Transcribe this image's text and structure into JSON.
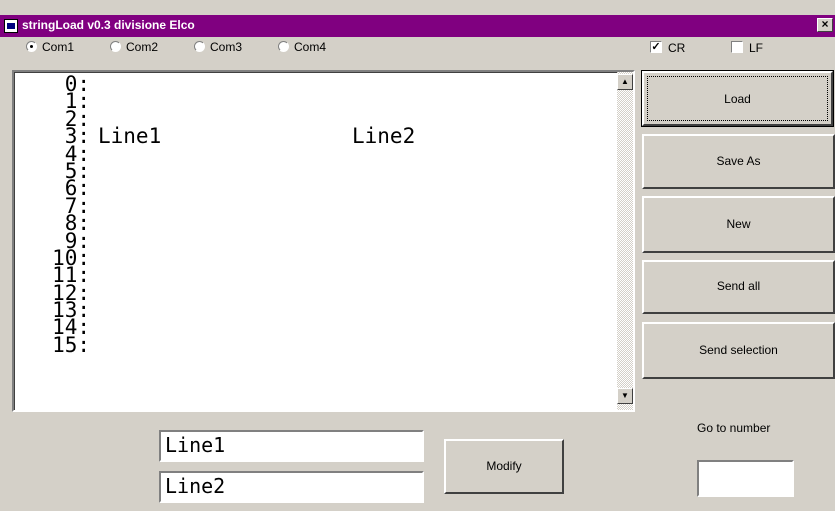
{
  "window": {
    "title": "stringLoad v0.3 divisione Elco",
    "close_glyph": "×"
  },
  "ports": [
    {
      "label": "Com1",
      "selected": true
    },
    {
      "label": "Com2",
      "selected": false
    },
    {
      "label": "Com3",
      "selected": false
    },
    {
      "label": "Com4",
      "selected": false
    }
  ],
  "options": {
    "cr": {
      "label": "CR",
      "checked": true
    },
    "lf": {
      "label": "LF",
      "checked": false
    }
  },
  "list": {
    "rows": [
      {
        "num": "0:",
        "col1": "",
        "col2": ""
      },
      {
        "num": "1:",
        "col1": "",
        "col2": ""
      },
      {
        "num": "2:",
        "col1": "",
        "col2": ""
      },
      {
        "num": "3:",
        "col1": "Line1",
        "col2": "Line2"
      },
      {
        "num": "4:",
        "col1": "",
        "col2": ""
      },
      {
        "num": "5:",
        "col1": "",
        "col2": ""
      },
      {
        "num": "6:",
        "col1": "",
        "col2": ""
      },
      {
        "num": "7:",
        "col1": "",
        "col2": ""
      },
      {
        "num": "8:",
        "col1": "",
        "col2": ""
      },
      {
        "num": "9:",
        "col1": "",
        "col2": ""
      },
      {
        "num": "10:",
        "col1": "",
        "col2": ""
      },
      {
        "num": "11:",
        "col1": "",
        "col2": ""
      },
      {
        "num": "12:",
        "col1": "",
        "col2": ""
      },
      {
        "num": "13:",
        "col1": "",
        "col2": ""
      },
      {
        "num": "14:",
        "col1": "",
        "col2": ""
      },
      {
        "num": "15:",
        "col1": "",
        "col2": ""
      }
    ]
  },
  "buttons": {
    "load": "Load",
    "save_as": "Save As",
    "new": "New",
    "send_all": "Send all",
    "send_selection": "Send selection",
    "modify": "Modify"
  },
  "editor": {
    "line1": "Line1",
    "line2": "Line2"
  },
  "goto": {
    "label": "Go to number",
    "value": ""
  }
}
